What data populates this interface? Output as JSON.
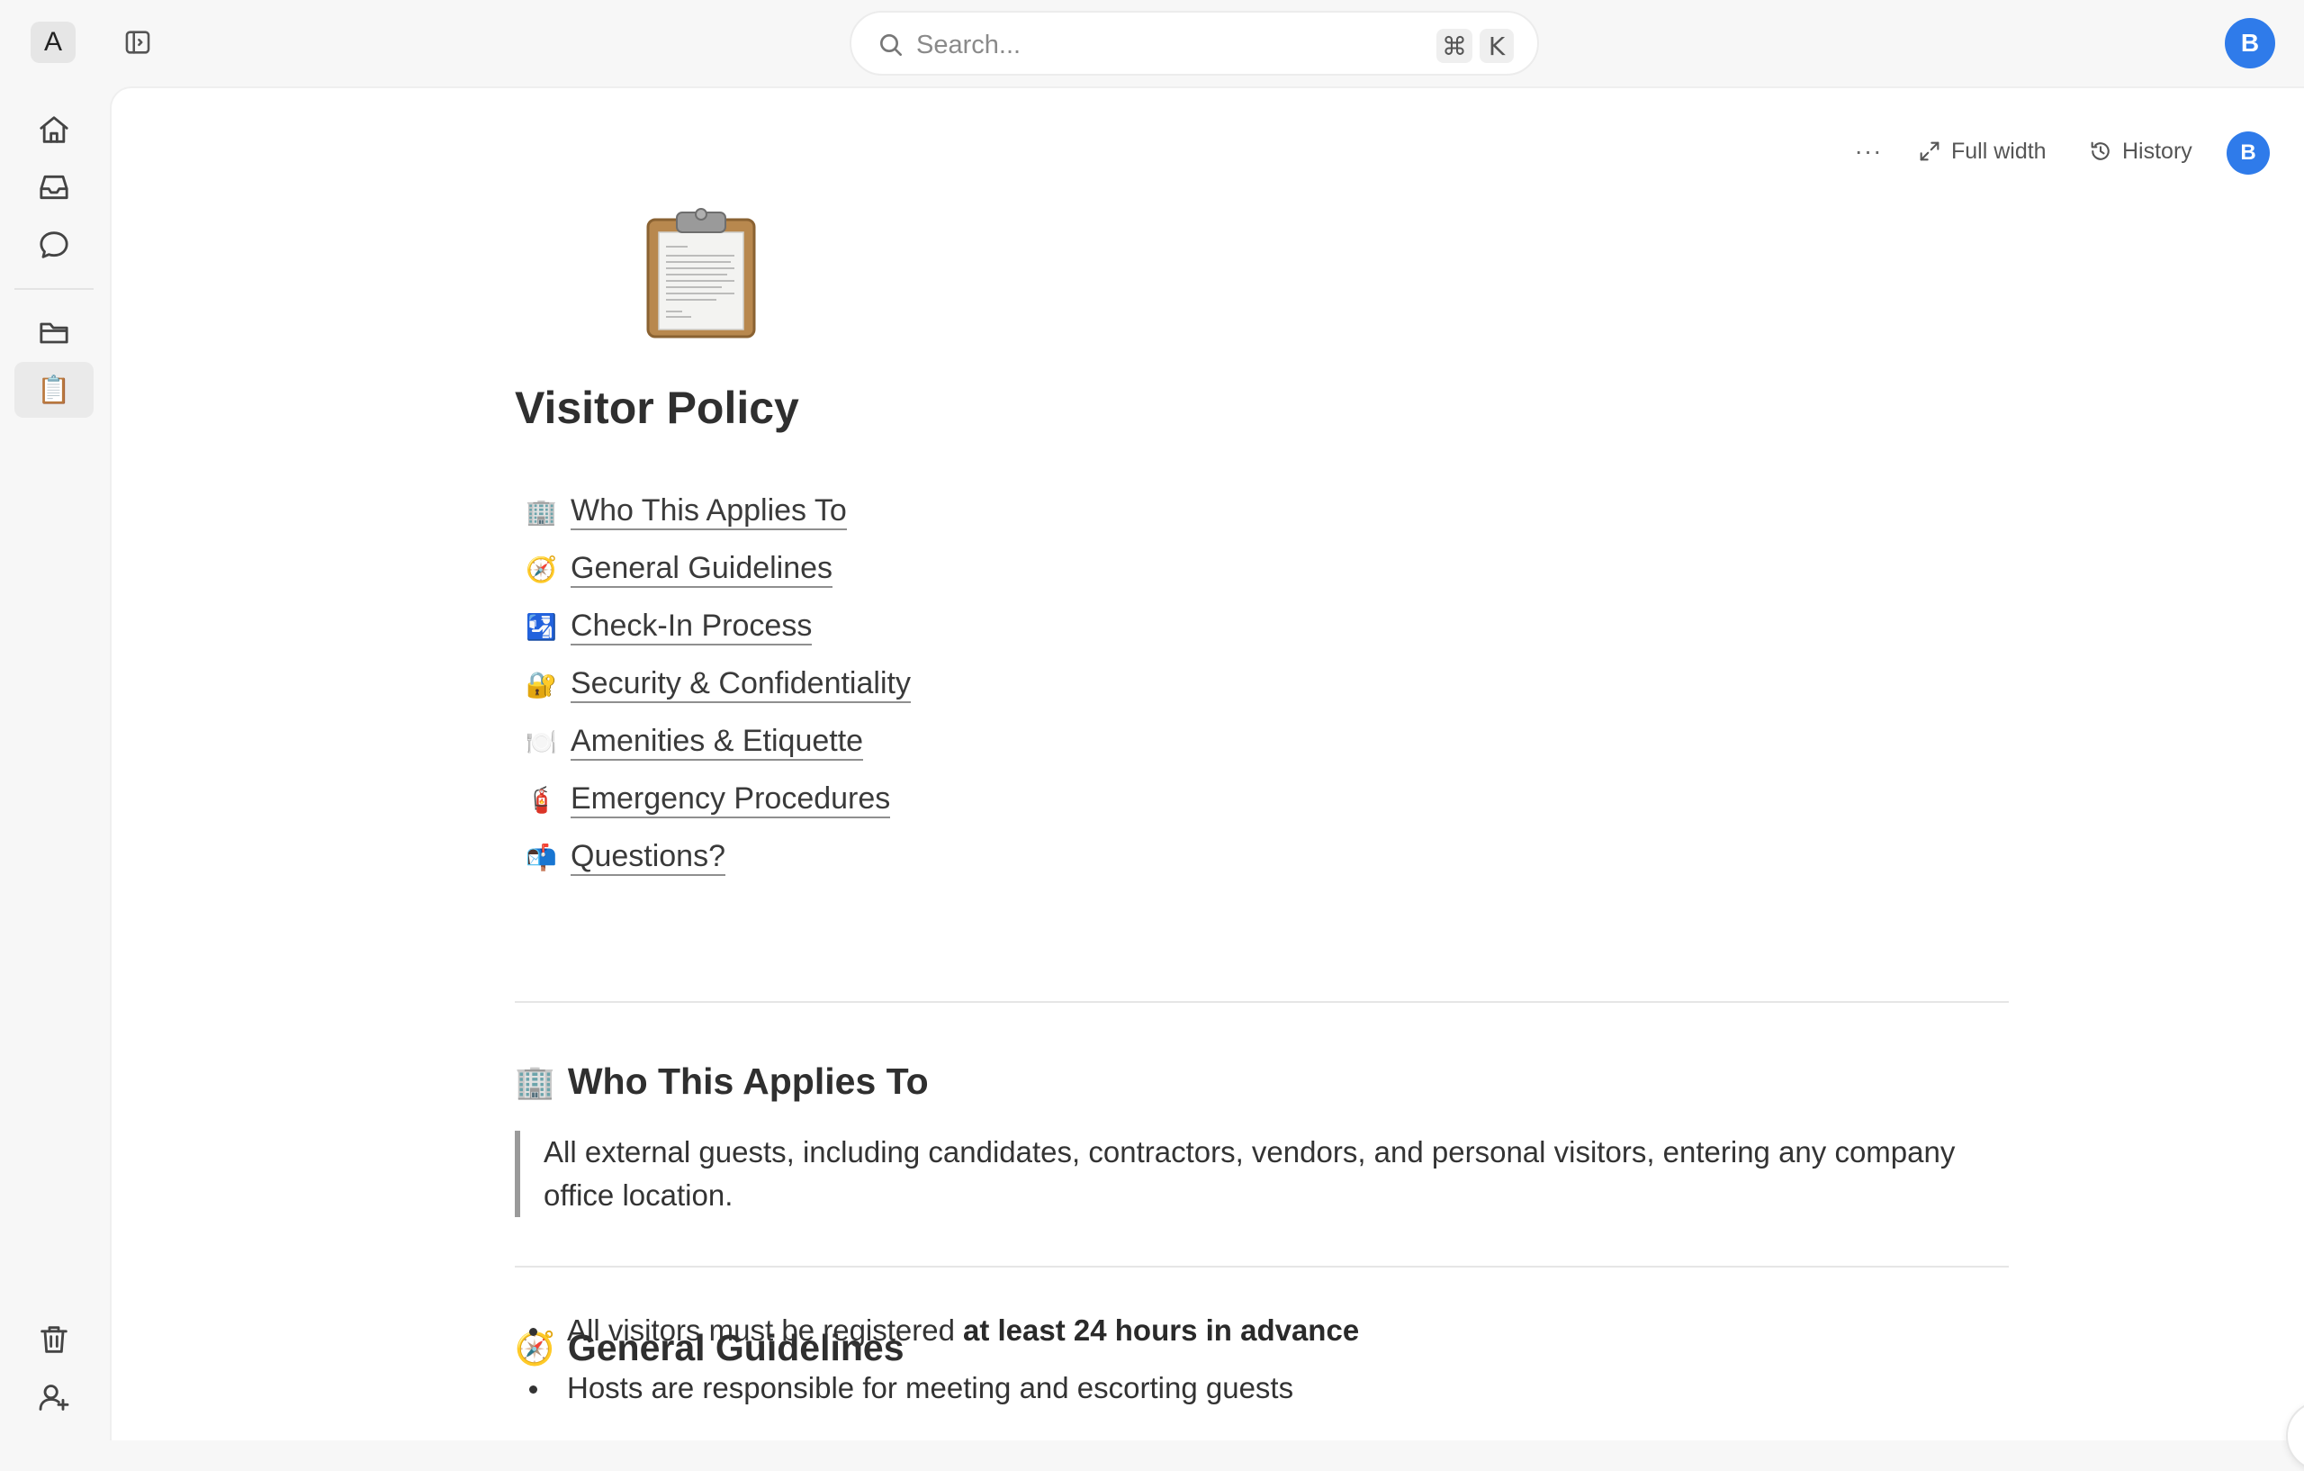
{
  "workspace": {
    "initial": "A"
  },
  "search": {
    "placeholder": "Search...",
    "shortcut_mod": "⌘",
    "shortcut_key": "K"
  },
  "user": {
    "initial": "B"
  },
  "rail": {
    "icons": [
      "home-icon",
      "inbox-icon",
      "chat-icon",
      "folder-icon",
      "clipboard-icon",
      "trash-icon",
      "add-user-icon"
    ],
    "active_emoji": "📋"
  },
  "page_actions": {
    "more": "···",
    "full_width": "Full width",
    "history": "History"
  },
  "page": {
    "emoji_icon": "clipboard-icon",
    "title": "Visitor Policy",
    "toc": [
      {
        "emoji": "🏢",
        "label": "Who This Applies To"
      },
      {
        "emoji": "🧭",
        "label": "General Guidelines"
      },
      {
        "emoji": "🛂",
        "label": "Check-In Process"
      },
      {
        "emoji": "🔐",
        "label": "Security & Confidentiality"
      },
      {
        "emoji": "🍽️",
        "label": "Amenities & Etiquette"
      },
      {
        "emoji": "🧯",
        "label": "Emergency Procedures"
      },
      {
        "emoji": "📬",
        "label": "Questions?"
      }
    ],
    "sections": {
      "applies": {
        "emoji": "🏢",
        "heading": "Who This Applies To",
        "quote": "All external guests, including candidates, contractors, vendors, and personal visitors, entering any company office location."
      },
      "guidelines": {
        "emoji": "🧭",
        "heading": "General Guidelines",
        "bullets": [
          {
            "text": "All visitors must be registered",
            "bold": "at least 24 hours in advance"
          },
          {
            "text": "Hosts are responsible for meeting and escorting guests",
            "bold": ""
          }
        ]
      }
    }
  },
  "colors": {
    "accent": "#2f7bea",
    "panel": "#ffffff",
    "background": "#f7f7f7"
  }
}
